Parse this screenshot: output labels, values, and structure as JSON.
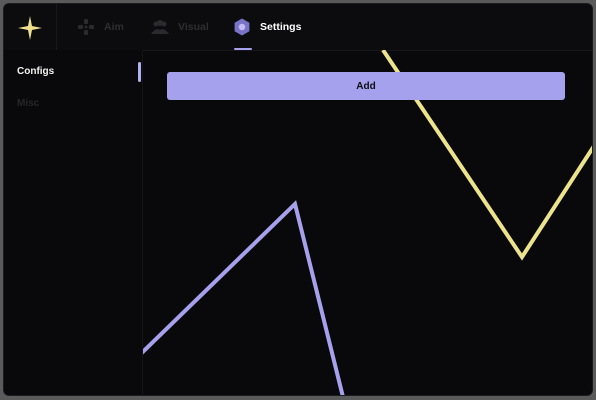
{
  "header": {
    "logo_icon": "four-point-star-icon",
    "tabs": [
      {
        "label": "Aim",
        "icon": "crosshair-dpad-icon",
        "active": false
      },
      {
        "label": "Visual",
        "icon": "people-icon",
        "active": false
      },
      {
        "label": "Settings",
        "icon": "gear-icon",
        "active": true
      }
    ]
  },
  "sidebar": {
    "items": [
      {
        "label": "Configs",
        "active": true
      },
      {
        "label": "Misc",
        "active": false
      }
    ]
  },
  "main": {
    "add_button_label": "Add"
  },
  "colors": {
    "accent": "#a6a1ec",
    "logo": "#f0e08c",
    "yellow_line": "#ece38c",
    "background": "#09090b"
  }
}
